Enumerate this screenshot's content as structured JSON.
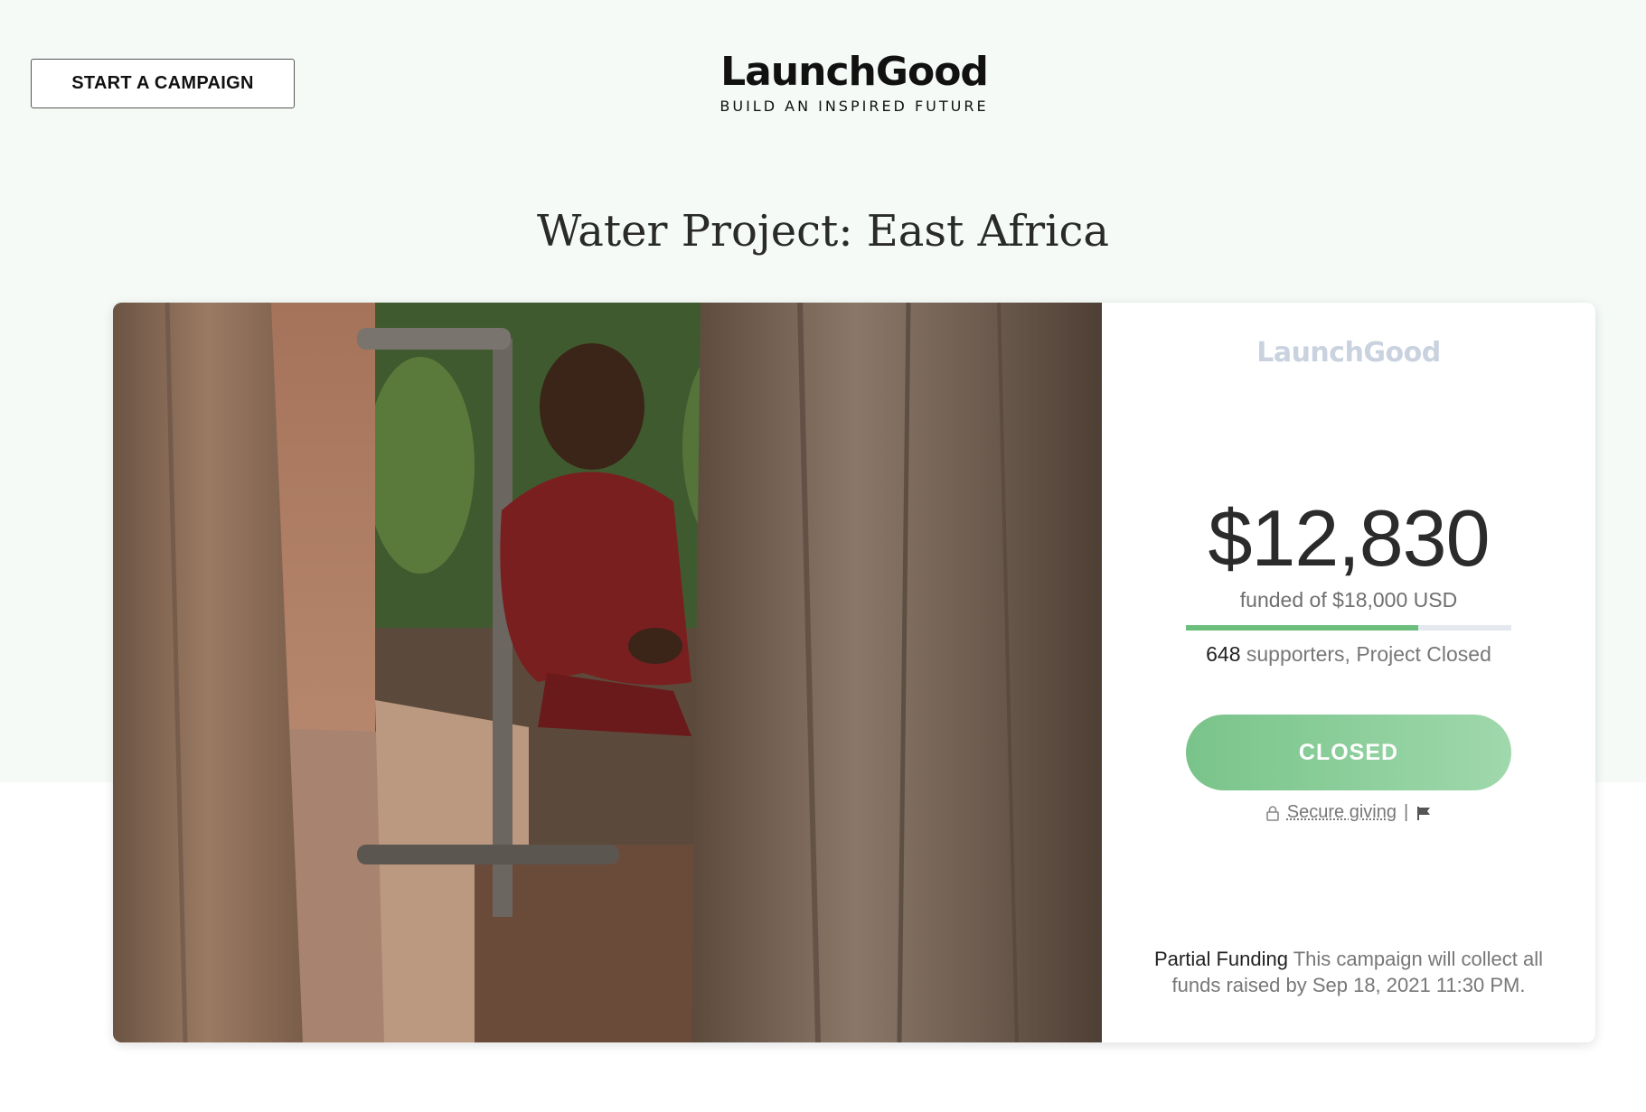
{
  "header": {
    "start_campaign_label": "START A CAMPAIGN",
    "logo_name": "LaunchGood",
    "logo_tagline": "BUILD AN INSPIRED FUTURE"
  },
  "campaign": {
    "title": "Water Project: East Africa",
    "panel_logo": "LaunchGood",
    "amount": "$12,830",
    "funded_of": "funded of $18,000 USD",
    "progress_fraction": 0.7128,
    "supporters_count": "648",
    "supporters_text": "supporters, Project Closed",
    "status_button": "CLOSED",
    "secure_giving": "Secure giving",
    "separator": "|",
    "partial_funding_label": "Partial Funding",
    "partial_funding_text": "This campaign will collect all funds raised by Sep 18, 2021 11:30 PM."
  },
  "icons": [
    "lock-icon",
    "flag-icon"
  ],
  "colors": {
    "accent_green": "#6cbe7d",
    "background_tint": "#f5faf6"
  }
}
